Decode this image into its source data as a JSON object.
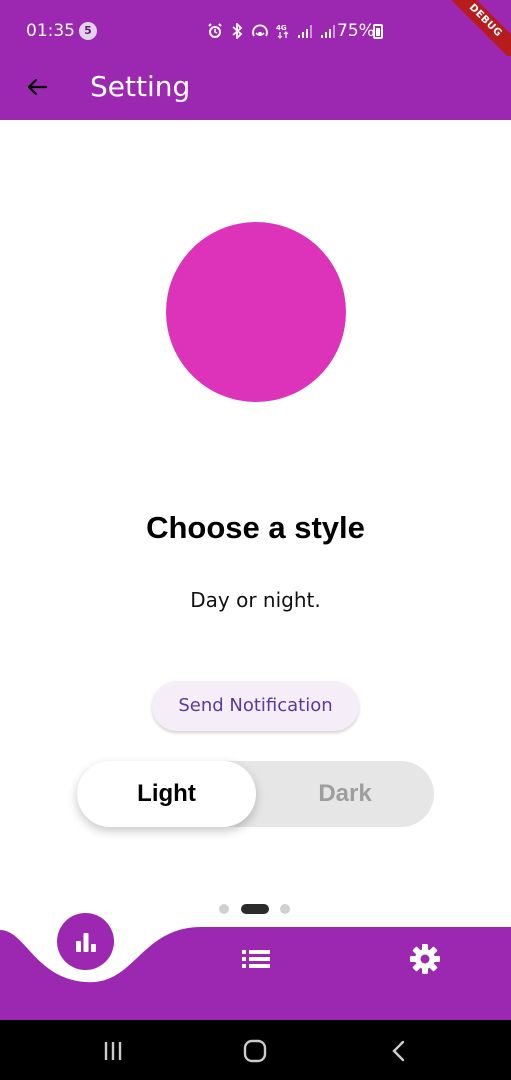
{
  "status_bar": {
    "time": "01:35",
    "notification_count": "5",
    "battery": "75%",
    "icons": [
      "alarm-icon",
      "bluetooth-icon",
      "hotspot-icon",
      "data-4g-icon",
      "signal-icon",
      "signal-icon"
    ]
  },
  "debug_banner": "DEBUG",
  "app_bar": {
    "title": "Setting",
    "back_icon": "arrow-back-icon"
  },
  "onboarding": {
    "heading": "Choose a style",
    "subtitle": "Day or night.",
    "circle_color": "#dd33bb",
    "notification_button": "Send Notification",
    "theme_toggle": {
      "options": [
        "Light",
        "Dark"
      ],
      "selected": "Light"
    },
    "pager": {
      "pages": 3,
      "current": 2
    }
  },
  "bottom_nav": {
    "items": [
      {
        "icon": "bar-chart-icon",
        "active": true
      },
      {
        "icon": "list-icon",
        "active": false
      },
      {
        "icon": "settings-gear-icon",
        "active": false
      }
    ]
  },
  "system_nav": [
    "recents-icon",
    "home-icon",
    "back-icon"
  ],
  "colors": {
    "primary": "#9c27b0",
    "toggle_track": "#e6e6e6",
    "button_text": "#5b3a9b"
  }
}
